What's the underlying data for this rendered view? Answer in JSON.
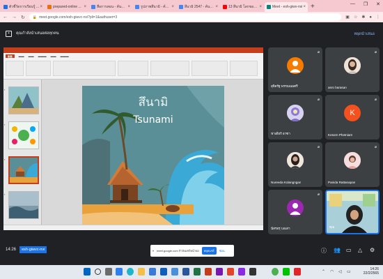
{
  "browser": {
    "tabs": [
      {
        "label": "ตัวชี้วัดการเรียนรู้ ...",
        "color": "#1a73e8"
      },
      {
        "label": "prepared-online ...",
        "color": "#e8710a"
      },
      {
        "label": "สื่อการสอน - ค้นหาด้วย ...",
        "color": "#4285f4"
      },
      {
        "label": "รูปภาพสึนามิ - ค้นหา ...",
        "color": "#4285f4"
      },
      {
        "label": "สึนามิ 2547 - ค้นหาด้วย ...",
        "color": "#4285f4"
      },
      {
        "label": "13 สึนามิ โลกของเรา ...",
        "color": "#ff0000"
      },
      {
        "label": "Meet - esh-giwv-nvi",
        "color": "#00897b",
        "active": true
      }
    ],
    "new_tab": "+",
    "url": "meet.google.com/esh-giwvc-nvi?pli=1&authuser=3"
  },
  "meet": {
    "presenting_text": "คุณกำลังนำเสนอต่อทุกคน",
    "stop_presenting": "หยุดนำเสนอ",
    "clock": "14:26",
    "meeting_code": "esh-giwvc-nvi",
    "share_bar": {
      "text": "meet.google.com กำลังแชร์หน้าจอ",
      "stop_label": "หยุดแชร์",
      "hide_label": "ซ่อน"
    }
  },
  "slide": {
    "title_th": "สึนามิ",
    "title_en": "Tsunami",
    "colors": {
      "sky": "#5b8f97",
      "wave": "#3aa9d6",
      "sand": "#e9a23b"
    }
  },
  "participants": [
    {
      "name": "สุจิตรัฐ พรรณนมศรี",
      "type": "avatar",
      "color": "#f57c00"
    },
    {
      "name": "asro barasan",
      "type": "photo",
      "color": "#d9b59c"
    },
    {
      "name": "ฟาเดียร์ อาซา",
      "type": "photo",
      "color": "#8b7bd8"
    },
    {
      "name": "Kesorn Phetniam",
      "type": "initial",
      "initial": "K",
      "color": "#f4511e"
    },
    {
      "name": "Nureeda Kolangngan",
      "type": "photo",
      "color": "#c9a48f"
    },
    {
      "name": "Panida Rattanapan",
      "type": "photo",
      "color": "#e6a5a5"
    },
    {
      "name": "นัสรอรุ บอเสา",
      "type": "avatar",
      "color": "#9c27b0"
    },
    {
      "name": "คุณ",
      "type": "self",
      "color": "#6fa8c9"
    }
  ],
  "taskbar": {
    "time": "14:26",
    "date": "22/2/2565"
  }
}
